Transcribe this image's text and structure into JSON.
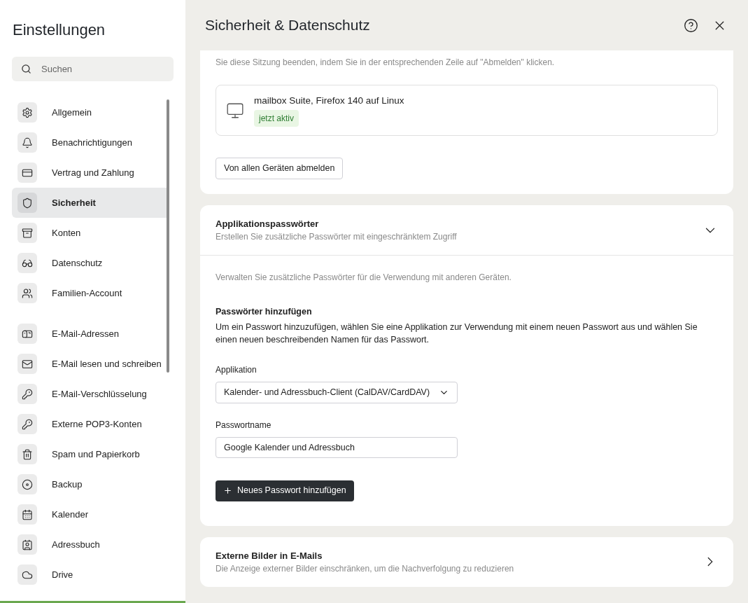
{
  "sidebar": {
    "title": "Einstellungen",
    "search": {
      "placeholder": "Suchen"
    },
    "groups": [
      [
        {
          "label": "Allgemein",
          "selected": false
        },
        {
          "label": "Benachrichtigungen",
          "selected": false
        },
        {
          "label": "Vertrag und Zahlung",
          "selected": false
        },
        {
          "label": "Sicherheit",
          "selected": true
        },
        {
          "label": "Konten",
          "selected": false
        },
        {
          "label": "Datenschutz",
          "selected": false
        },
        {
          "label": "Familien-Account",
          "selected": false
        }
      ],
      [
        {
          "label": "E-Mail-Adressen",
          "selected": false
        },
        {
          "label": "E-Mail lesen und schreiben",
          "selected": false
        },
        {
          "label": "E-Mail-Verschlüsselung",
          "selected": false
        },
        {
          "label": "Externe POP3-Konten",
          "selected": false
        },
        {
          "label": "Spam und Papierkorb",
          "selected": false
        },
        {
          "label": "Backup",
          "selected": false
        },
        {
          "label": "Kalender",
          "selected": false
        },
        {
          "label": "Adressbuch",
          "selected": false
        },
        {
          "label": "Drive",
          "selected": false
        }
      ]
    ]
  },
  "header": {
    "title": "Sicherheit & Datenschutz"
  },
  "sessions": {
    "intro": "Sie diese Sitzung beenden, indem Sie in der entsprechenden Zeile auf \"Abmelden\" klicken.",
    "devices": [
      {
        "name": "mailbox Suite, Firefox 140 auf Linux",
        "status": "jetzt aktiv"
      }
    ],
    "logout_all": "Von allen Geräten abmelden"
  },
  "app_passwords": {
    "title": "Applikationspasswörter",
    "subtitle": "Erstellen Sie zusätzliche Passwörter mit eingeschränktem Zugriff",
    "expanded": true,
    "intro": "Verwalten Sie zusätzliche Passwörter für die Verwendung mit anderen Geräten.",
    "add_title": "Passwörter hinzufügen",
    "add_text": "Um ein Passwort hinzuzufügen, wählen Sie eine Applikation zur Verwendung mit einem neuen Passwort aus und wählen Sie einen neuen beschreibenden Namen für das Passwort.",
    "application": {
      "label": "Applikation",
      "value": "Kalender- und Adressbuch-Client (CalDAV/CardDAV)"
    },
    "password_name": {
      "label": "Passwortname",
      "value": "Google Kalender und Adressbuch"
    },
    "add_button": "Neues Passwort hinzufügen"
  },
  "external_images": {
    "title": "Externe Bilder in E-Mails",
    "subtitle": "Die Anzeige externer Bilder einschränken, um die Nachverfolgung zu reduzieren",
    "expanded": false
  }
}
